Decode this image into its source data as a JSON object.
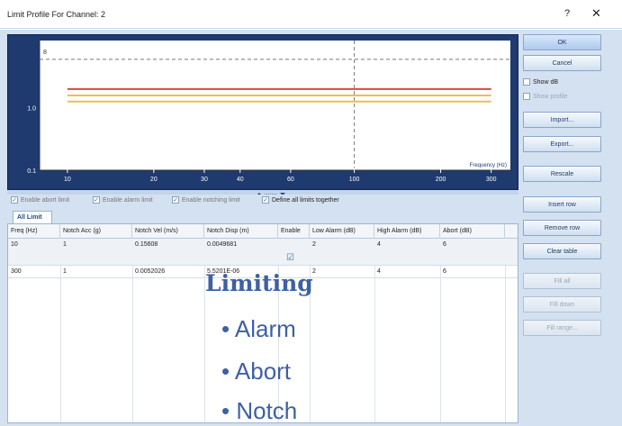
{
  "window": {
    "title": "Limit Profile For Channel: 2",
    "help_glyph": "?",
    "close_glyph": "✕"
  },
  "chart_data": {
    "type": "line",
    "x_scale": "log",
    "y_scale": "log",
    "xlim": [
      8,
      350
    ],
    "ylim": [
      0.1,
      12
    ],
    "x_ticks": [
      "10",
      "20",
      "30",
      "40",
      "60",
      "100",
      "200",
      "300"
    ],
    "y_ticks": [
      "8",
      "1.0",
      "0.1"
    ],
    "xlabel": "Frequency (Hz)",
    "series": [
      {
        "color": "#d84a3a",
        "x": [
          10,
          300
        ],
        "y": [
          2,
          2
        ]
      },
      {
        "color": "#e9c04b",
        "x": [
          10,
          300
        ],
        "y": [
          1.58,
          1.58
        ]
      },
      {
        "color": "#e9c04b",
        "x": [
          10,
          300
        ],
        "y": [
          1.26,
          1.26
        ]
      }
    ],
    "vertical_marker": 100,
    "horizontal_marker": 6
  },
  "options": [
    {
      "label": "Enable abort limit",
      "checked": true,
      "enabled": false
    },
    {
      "label": "Enable alarm limit",
      "checked": true,
      "enabled": false
    },
    {
      "label": "Enable notching limit",
      "checked": true,
      "enabled": false
    },
    {
      "label": "Define all limits together",
      "checked": true,
      "enabled": true
    }
  ],
  "tab_label": "All Limit",
  "table": {
    "headers": [
      "Freq (Hz)",
      "Notch Acc (g)",
      "Notch Vel (m/s)",
      "Notch Disp (m)",
      "Enable",
      "Low Alarm (dB)",
      "High Alarm (dB)",
      "Abort (dB)"
    ],
    "rows": [
      [
        "10",
        "1",
        "0.15608",
        "0.0049681",
        "",
        "2",
        "4",
        "6"
      ],
      [
        "300",
        "1",
        "0.0052026",
        "5.5201E-06",
        "",
        "2",
        "4",
        "6"
      ]
    ],
    "enable_check": "☑"
  },
  "overlay": {
    "heading": "Limiting",
    "bullets": [
      "• Alarm",
      "• Abort",
      "• Notch"
    ]
  },
  "buttons": {
    "ok": "OK",
    "cancel": "Cancel",
    "import": "Import...",
    "export": "Export...",
    "rescale": "Rescale",
    "insert_row": "Insert row",
    "remove_row": "Remove row",
    "clear_table": "Clear table",
    "fill_all": "Fill all",
    "fill_down": "Fill down",
    "fill_range": "Fill range..."
  },
  "checks": {
    "show_db": "Show dB",
    "show_profile": "Show profile"
  }
}
